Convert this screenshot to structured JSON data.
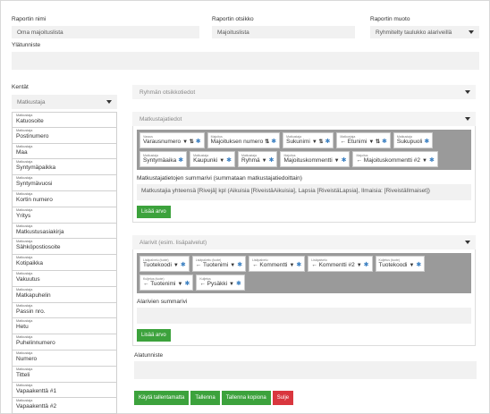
{
  "report": {
    "name_label": "Raportin nimi",
    "name_value": "Oma majoituslista",
    "title_label": "Raportin otsikko",
    "title_value": "Majoituslista",
    "format_label": "Raportin muoto",
    "format_value": "Ryhmitelty taulukko alariveillä",
    "header_label": "Ylätunniste",
    "header_value": ""
  },
  "fields": {
    "label": "Kentät",
    "selected": "Matkustaja",
    "items": [
      {
        "category": "Matkustaja",
        "name": "Katuosoite"
      },
      {
        "category": "Matkustaja",
        "name": "Postinumero"
      },
      {
        "category": "Matkustaja",
        "name": "Maa"
      },
      {
        "category": "Matkustaja",
        "name": "Syntymäpaikka"
      },
      {
        "category": "Matkustaja",
        "name": "Syntymävuosi"
      },
      {
        "category": "Matkustaja",
        "name": "Kortin numero"
      },
      {
        "category": "Matkustaja",
        "name": "Yritys"
      },
      {
        "category": "Matkustaja",
        "name": "Matkustusasiakirja"
      },
      {
        "category": "Matkustaja",
        "name": "Sähköpostiosoite"
      },
      {
        "category": "Matkustaja",
        "name": "Kotipaikka"
      },
      {
        "category": "Matkustaja",
        "name": "Vakuutus"
      },
      {
        "category": "Matkustaja",
        "name": "Matkapuhelin"
      },
      {
        "category": "Matkustaja",
        "name": "Passin nro."
      },
      {
        "category": "Matkustaja",
        "name": "Hetu"
      },
      {
        "category": "Matkustaja",
        "name": "Puhelinnumero"
      },
      {
        "category": "Matkustaja",
        "name": "Numero"
      },
      {
        "category": "Matkustaja",
        "name": "Titteli"
      },
      {
        "category": "Matkustaja",
        "name": "Vapaakenttä #1"
      },
      {
        "category": "Matkustaja",
        "name": "Vapaakenttä #2"
      }
    ]
  },
  "group_headers": {
    "placeholder": "Ryhmän otsikkotiedot"
  },
  "traveler_info": {
    "title": "Matkustajatiedot",
    "row1": [
      {
        "sub": "Varaus",
        "main": "Varausnumero",
        "icons": "▼ ⇅"
      },
      {
        "sub": "Majoitus",
        "main": "Majoituksen numero",
        "icons": "⇅"
      },
      {
        "sub": "Matkustaja",
        "main": "Sukunimi",
        "icons": "▼ ⇅"
      },
      {
        "sub": "Matkustaja",
        "main": "← Etunimi",
        "icons": "▼ ⇅"
      },
      {
        "sub": "Matkustaja",
        "main": "Sukupuoli",
        "icons": ""
      }
    ],
    "row2": [
      {
        "sub": "Matkustaja",
        "main": "Syntymäaika",
        "icons": ""
      },
      {
        "sub": "Matkustaja",
        "main": "Kaupunki",
        "icons": "▼"
      },
      {
        "sub": "Matkustaja",
        "main": "Ryhmä",
        "icons": "▼"
      },
      {
        "sub": "Majoitus",
        "main": "Majoituskommentti",
        "icons": "▼"
      },
      {
        "sub": "Majoitus",
        "main": "← Majoituskommentti #2",
        "icons": "▼"
      }
    ],
    "summary_label": "Matkustajatietojen summarivi (summataan matkustajatiedoittain)",
    "summary_value": "Matkustajia yhteensä [Rivejä] kpl (Aikuisia [RiveistäAikuisia], Lapsia [RiveistäLapsia], Ilmaisia: [RiveistäIlmaiset])",
    "add_button": "Lisää arvo"
  },
  "sub_rows": {
    "title": "Alarivit (esim. lisäpalvelut)",
    "row1": [
      {
        "sub": "Lisäpalvelu (tuote)",
        "main": "Tuotekoodi",
        "icons": "▼"
      },
      {
        "sub": "Lisäpalvelu (tuote)",
        "main": "← Tuotenimi",
        "icons": "▼"
      },
      {
        "sub": "Lisäpalvelu",
        "main": "← Kommentti",
        "icons": "▼"
      },
      {
        "sub": "Lisäpalvelu",
        "main": "← Kommentti #2",
        "icons": "▼"
      },
      {
        "sub": "Kuljetus (tuote)",
        "main": "Tuotekoodi",
        "icons": "▼"
      }
    ],
    "row2": [
      {
        "sub": "Kuljetus (tuote)",
        "main": "← Tuotenimi",
        "icons": "▼"
      },
      {
        "sub": "Kuljetus",
        "main": "← Pysäkki",
        "icons": "▼"
      }
    ],
    "summary_label": "Alarivien summarivi",
    "summary_value": "",
    "add_button": "Lisää arvo"
  },
  "footer": {
    "label": "Alatunniste",
    "value": ""
  },
  "actions": {
    "use_unsaved": "Käytä tallentamatta",
    "save": "Tallenna",
    "save_copy": "Tallenna kopiona",
    "close": "Sulje"
  },
  "colors": {
    "green": "#3ca23c",
    "red": "#d9363e",
    "gear": "#3a7fc1",
    "chip_bg": "#9a9a9a"
  }
}
